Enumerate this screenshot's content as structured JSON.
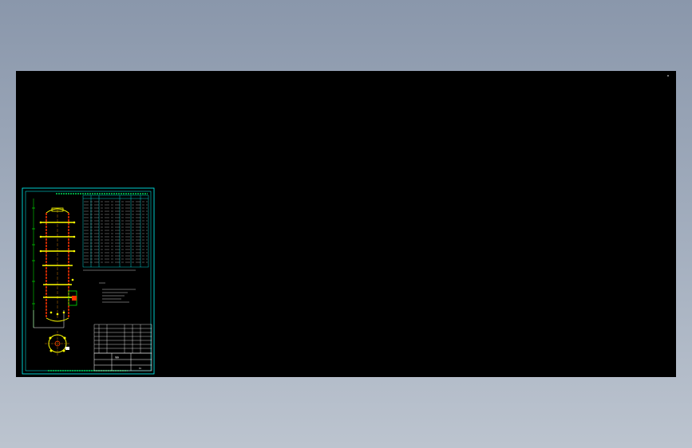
{
  "viewport": {
    "background": "#000000",
    "border_color": "#00ffff",
    "vessel_color": "#ffff00",
    "shell_color": "#ff3300",
    "table_line_color": "#00ffff",
    "text_color": "#ffffff"
  },
  "drawing": {
    "title_block_name": "塔器",
    "drawing_no": "01"
  }
}
